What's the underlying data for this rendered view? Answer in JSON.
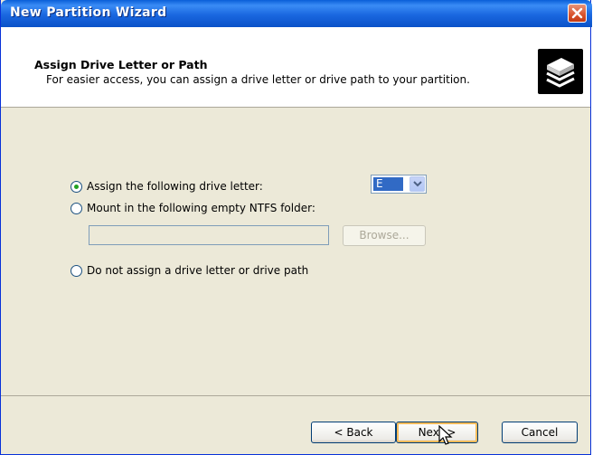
{
  "window": {
    "title": "New Partition Wizard"
  },
  "header": {
    "title": "Assign Drive Letter or Path",
    "subtitle": "For easier access, you can assign a drive letter or drive path to your partition."
  },
  "options": {
    "assign_letter": {
      "label": "Assign the following drive letter:",
      "checked": true
    },
    "mount_folder": {
      "label": "Mount in the following empty NTFS folder:",
      "checked": false
    },
    "no_assign": {
      "label": "Do not assign a drive letter or drive path",
      "checked": false
    }
  },
  "drive_letter": {
    "selected": "E"
  },
  "folder_path": {
    "value": ""
  },
  "buttons": {
    "browse": "Browse...",
    "back": "< Back",
    "next": "Next >",
    "cancel": "Cancel"
  },
  "icons": {
    "close": "close-icon",
    "wizard": "drive-wizard-icon",
    "dropdown": "chevron-down-icon",
    "cursor": "mouse-pointer-icon"
  }
}
